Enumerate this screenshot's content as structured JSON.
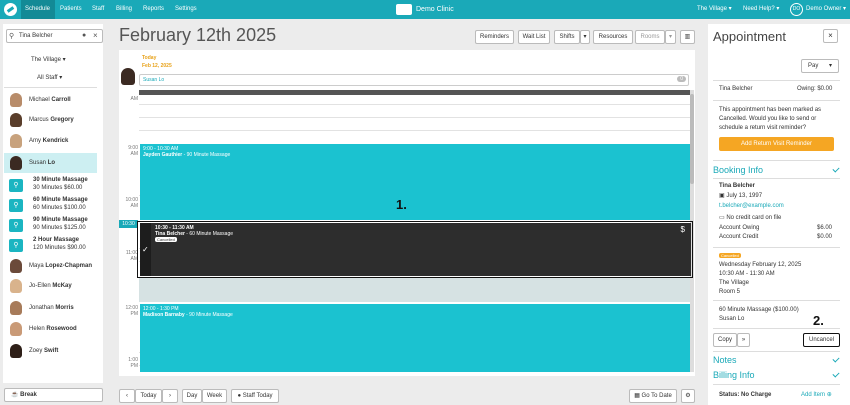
{
  "nav": {
    "schedule": "Schedule",
    "patients": "Patients",
    "staff": "Staff",
    "billing": "Billing",
    "reports": "Reports",
    "settings": "Settings",
    "brand": "Demo Clinic",
    "location": "The Village",
    "help": "Need Help?",
    "user_initials": "DO",
    "user": "Demo Owner"
  },
  "left": {
    "search_value": "Tina Belcher",
    "location_select": "The Village",
    "staff_select": "All Staff",
    "break_label": "Break",
    "staff": [
      {
        "first": "Michael",
        "last": "Carroll"
      },
      {
        "first": "Marcus",
        "last": "Gregory"
      },
      {
        "first": "Amy",
        "last": "Kendrick"
      },
      {
        "first": "Susan",
        "last": "Lo"
      }
    ],
    "services": [
      {
        "name": "30 Minute Massage",
        "detail": "30 Minutes $60.00"
      },
      {
        "name": "60 Minute Massage",
        "detail": "60 Minutes $100.00"
      },
      {
        "name": "90 Minute Massage",
        "detail": "90 Minutes $125.00"
      },
      {
        "name": "2 Hour Massage",
        "detail": "120 Minutes $90.00"
      }
    ],
    "staff2": [
      {
        "first": "Maya",
        "last": "Lopez-Chapman"
      },
      {
        "first": "Jo-Ellen",
        "last": "McKay"
      },
      {
        "first": "Jonathan",
        "last": "Morris"
      },
      {
        "first": "Helen",
        "last": "Rosewood"
      },
      {
        "first": "Zoey",
        "last": "Swift"
      }
    ]
  },
  "calendar": {
    "date_title": "February 12th 2025",
    "toolbar": {
      "reminders": "Reminders",
      "wait_list": "Wait List",
      "shifts": "Shifts",
      "resources": "Resources",
      "rooms": "Rooms"
    },
    "today_label": "Today",
    "today_date": "Feb 12, 2025",
    "staff_name": "Susan Lo",
    "count_badge": "0",
    "hours": [
      {
        "t": "AM"
      },
      {
        "t": "9:00",
        "s": "AM"
      },
      {
        "t": "10:00",
        "s": "AM"
      },
      {
        "t": "11:00",
        "s": "AM"
      },
      {
        "t": "12:00",
        "s": "PM"
      },
      {
        "t": "1:00",
        "s": "PM"
      }
    ],
    "now_marker": "10:30",
    "appointments": [
      {
        "time": "9:00 - 10:30 AM",
        "client": "Jayden Gauthier",
        "service": "90 Minute Massage"
      },
      {
        "time": "10:30 - 11:30 AM",
        "client": "Tina Belcher",
        "service": "60 Minute Massage",
        "badge": "Cancelled",
        "price_sym": "$"
      },
      {
        "time": "12:00 - 1:30 PM",
        "client": "Madison Barnaby",
        "service": "90 Minute Massage"
      }
    ],
    "step1": "1.",
    "bottom": {
      "today": "Today",
      "day": "Day",
      "week": "Week",
      "staff_today": "Staff Today",
      "go_to_date": "Go To Date"
    }
  },
  "appointment": {
    "title": "Appointment",
    "pay": "Pay",
    "client": "Tina Belcher",
    "owing": "Owing: $0.00",
    "cancel_message": "This appointment has been marked as Cancelled. Would you like to send or schedule a return visit reminder?",
    "reminder_button": "Add Return Visit Reminder",
    "booking_title": "Booking Info",
    "dob": "July 13, 1997",
    "email": "t.belcher@example.com",
    "card": "No credit card on file",
    "account_owing_label": "Account Owing",
    "account_owing": "$6.00",
    "account_credit_label": "Account Credit",
    "account_credit": "$0.00",
    "status_badge": "Cancelled",
    "appt_date": "Wednesday February 12, 2025",
    "appt_time": "10:30 AM - 11:30 AM",
    "appt_location": "The Village",
    "appt_room": "Room 5",
    "appt_service": "60 Minute Massage ($100.00)",
    "appt_staff": "Susan Lo",
    "copy": "Copy",
    "uncancel": "Uncancel",
    "step2": "2.",
    "notes_title": "Notes",
    "billing_title": "Billing Info",
    "status_label": "Status: No Charge",
    "add_item": "Add Item"
  }
}
